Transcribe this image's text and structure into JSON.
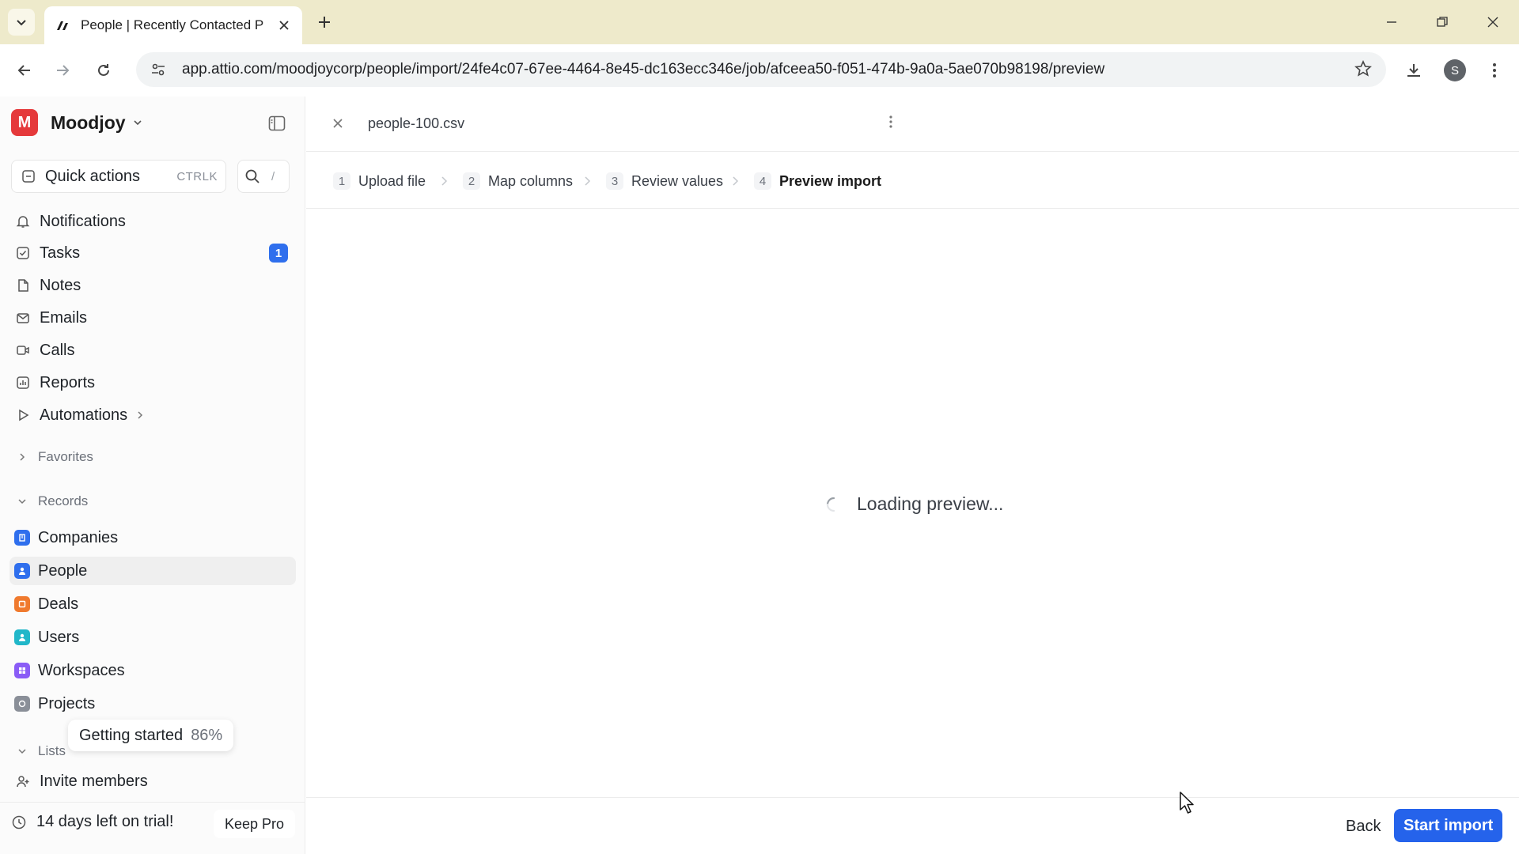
{
  "browser": {
    "tab_title": "People | Recently Contacted People",
    "url": "app.attio.com/moodjoycorp/people/import/24fe4c07-67ee-4464-8e45-dc163ecc346e/job/afceea50-f051-474b-9a0a-5ae070b98198/preview",
    "profile_initial": "S"
  },
  "sidebar": {
    "workspace_name": "Moodjoy",
    "workspace_initial": "M",
    "quick_actions_label": "Quick actions",
    "quick_actions_shortcut": "CTRLK",
    "search_shortcut": "/",
    "nav": [
      {
        "label": "Notifications",
        "icon": "bell-icon"
      },
      {
        "label": "Tasks",
        "icon": "checkbox-icon",
        "count": "1"
      },
      {
        "label": "Notes",
        "icon": "note-icon"
      },
      {
        "label": "Emails",
        "icon": "mail-icon"
      },
      {
        "label": "Calls",
        "icon": "video-icon"
      },
      {
        "label": "Reports",
        "icon": "chart-icon"
      },
      {
        "label": "Automations",
        "icon": "play-icon"
      }
    ],
    "favorites_label": "Favorites",
    "records_label": "Records",
    "records": [
      {
        "label": "Companies",
        "color": "#2f6fed"
      },
      {
        "label": "People",
        "color": "#2f6fed"
      },
      {
        "label": "Deals",
        "color": "#f07a2e"
      },
      {
        "label": "Users",
        "color": "#21b7c9"
      },
      {
        "label": "Workspaces",
        "color": "#8a5cf6"
      },
      {
        "label": "Projects",
        "color": "#8a8f98"
      }
    ],
    "lists_label": "Lists",
    "getting_started_label": "Getting started",
    "getting_started_pct": "86%",
    "invite_label": "Invite members",
    "trial_label": "14 days left on trial!",
    "keep_pro_label": "Keep Pro"
  },
  "main": {
    "filename": "people-100.csv",
    "steps": [
      {
        "num": "1",
        "label": "Upload file"
      },
      {
        "num": "2",
        "label": "Map columns"
      },
      {
        "num": "3",
        "label": "Review values"
      },
      {
        "num": "4",
        "label": "Preview import"
      }
    ],
    "loading_text": "Loading preview...",
    "back_label": "Back",
    "start_label": "Start import"
  },
  "colors": {
    "accent": "#2563eb",
    "tabbar": "#eeeacb",
    "workspace_logo": "#e5393b"
  }
}
